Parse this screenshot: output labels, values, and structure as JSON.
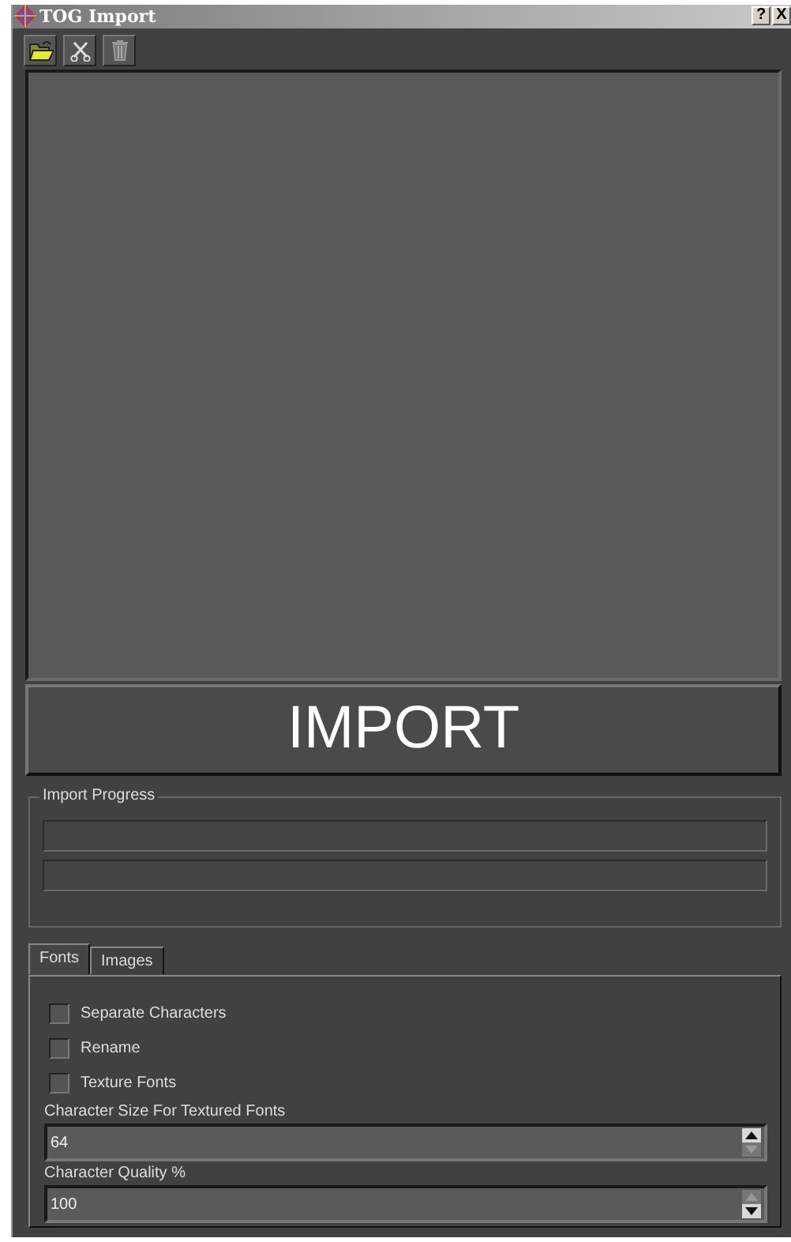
{
  "window": {
    "title": "TOG Import",
    "buttons": [
      "?",
      "X"
    ]
  },
  "toolbar": [
    {
      "kind": "open"
    },
    {
      "kind": "cut"
    },
    {
      "kind": "delete"
    }
  ],
  "import_button": "IMPORT",
  "progress": {
    "title": "Import Progress",
    "bars": [
      {
        "level": 0
      },
      {
        "level": 0
      }
    ]
  },
  "tabs": [
    {
      "label": "Fonts",
      "selected": true
    },
    {
      "label": "Images",
      "selected": false
    }
  ],
  "options": [
    {
      "label": "Separate Characters",
      "checked": false
    },
    {
      "label": "Rename",
      "checked": false
    },
    {
      "label": "Texture Fonts",
      "checked": false
    }
  ],
  "fields": [
    {
      "label": "Character Size For Textured Fonts",
      "value": "64",
      "up_disabled": false,
      "down_disabled": true
    },
    {
      "label": "Character Quality %",
      "value": "100",
      "up_disabled": true,
      "down_disabled": false
    }
  ]
}
